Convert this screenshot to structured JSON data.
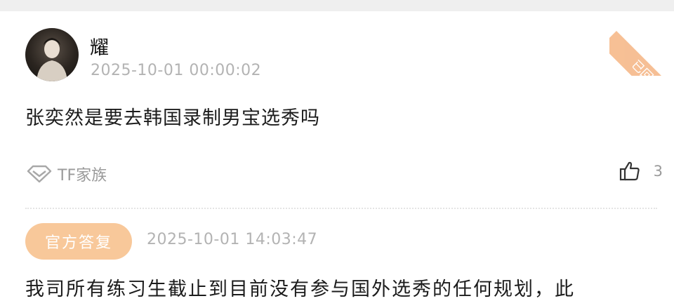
{
  "comment": {
    "username": "耀",
    "time": "2025-10-01 00:00:02",
    "text": "张奕然是要去韩国录制男宝选秀吗",
    "tag": "TF家族",
    "likes": "3"
  },
  "stamp": {
    "label": "已回复"
  },
  "reply": {
    "badge": "官方答复",
    "time": "2025-10-01 14:03:47",
    "text": "我司所有练习生截止到目前没有参与国外选秀的任何规划，此"
  },
  "colors": {
    "badge_bg": "#f8c89a",
    "muted_text": "#b3b3b3",
    "tag_text": "#9a9a9a"
  }
}
